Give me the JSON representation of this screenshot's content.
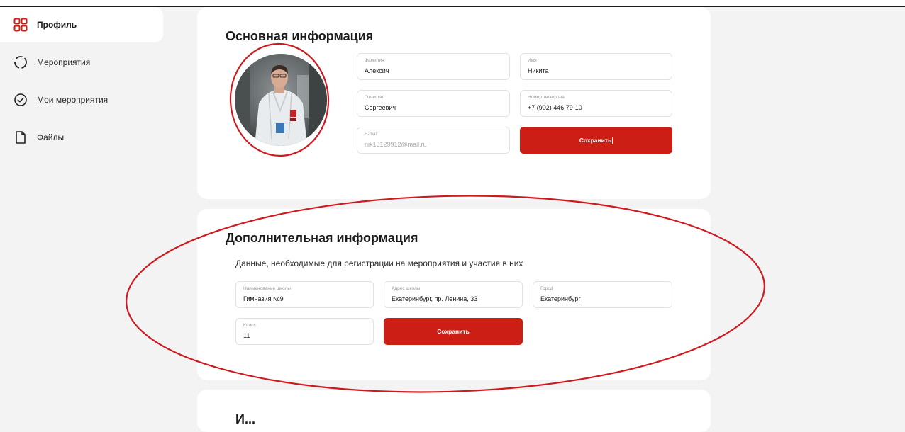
{
  "sidebar": {
    "items": [
      {
        "label": "Профиль",
        "icon": "grid-icon",
        "active": true
      },
      {
        "label": "Мероприятия",
        "icon": "dashed-circle-icon",
        "active": false
      },
      {
        "label": "Мои мероприятия",
        "icon": "check-circle-icon",
        "active": false
      },
      {
        "label": "Файлы",
        "icon": "file-icon",
        "active": false
      }
    ]
  },
  "basic_info": {
    "title": "Основная информация",
    "fields": {
      "last_name": {
        "label": "Фамилия",
        "value": "Алексич"
      },
      "first_name": {
        "label": "Имя",
        "value": "Никита"
      },
      "patronymic": {
        "label": "Отчество",
        "value": "Сергеевич"
      },
      "phone": {
        "label": "Номер телефона",
        "value": "+7 (902) 446 79-10"
      },
      "email": {
        "label": "E-mail",
        "value": "nik15129912@mail.ru"
      }
    },
    "save_label": "Сохранить"
  },
  "additional_info": {
    "title": "Дополнительная информация",
    "subtitle": "Данные, необходимые для регистрации на мероприятия и участия в них",
    "fields": {
      "school_name": {
        "label": "Наименование школы",
        "value": "Гимназия №9"
      },
      "school_address": {
        "label": "Адрес школы",
        "value": "Екатеринбург, пр. Ленина, 33"
      },
      "city": {
        "label": "Город",
        "value": "Екатеринбург"
      },
      "grade": {
        "label": "Класс",
        "value": "11"
      }
    },
    "save_label": "Сохранить"
  },
  "third_section": {
    "title": "И..."
  },
  "colors": {
    "accent": "#cc1e14",
    "background": "#f3f3f3",
    "card": "#ffffff",
    "annotation": "#d0191e"
  }
}
